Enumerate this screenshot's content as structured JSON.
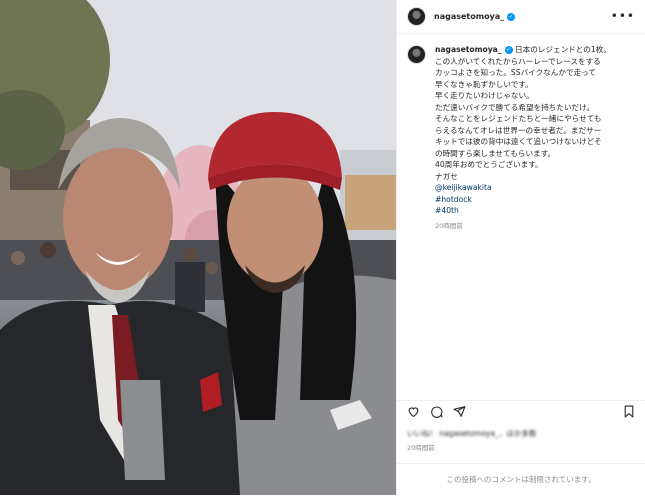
{
  "post": {
    "username": "nagasetomoya_",
    "verified_icon": "verified-badge-icon",
    "more_icon": "more-options-icon",
    "caption": {
      "lines": [
        "日本のレジェンドとの1枚。",
        "この人がいてくれたからハーレーでレースをする",
        "カッコよさを知った。SSバイクなんかで走って",
        "早くなきゃ恥ずかしいです。",
        "早く走りたいわけじゃない。",
        "ただ速いバイクで勝てる希望を持ちたいだけ。",
        "そんなことをレジェンドたちと一緒にやらせても",
        "らえるなんてオレは世界一の幸せ者だ。まだサー",
        "キットでは彼の背中は遠くて追いつけないけどそ",
        "の時間すら楽しませてもらいます。",
        "40周年おめでとうございます。",
        "ナガセ"
      ],
      "tags": [
        "@keijikawakita",
        "#hotdock",
        "#40th"
      ],
      "time": "20時間前"
    },
    "actions": {
      "like_icon": "heart-icon",
      "comment_icon": "comment-icon",
      "share_icon": "share-icon",
      "save_icon": "bookmark-icon"
    },
    "likes_text": "いいね！ nagasetomoya_、ほか多数",
    "time_footer": "20時間前",
    "comment_disabled": "この投稿へのコメントは制限されています。"
  },
  "colors": {
    "link": "#00376b",
    "verified": "#0095f6",
    "muted": "#8e8e8e",
    "text": "#262626"
  }
}
